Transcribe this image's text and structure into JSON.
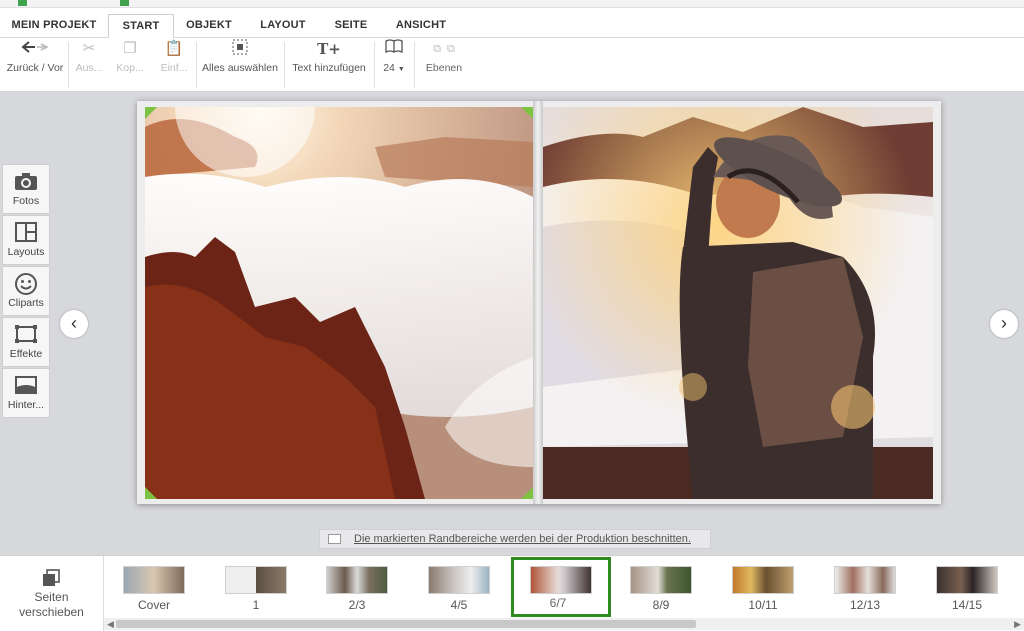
{
  "menu": {
    "tabs": [
      {
        "label": "MEIN PROJEKT"
      },
      {
        "label": "START"
      },
      {
        "label": "OBJEKT"
      },
      {
        "label": "LAYOUT"
      },
      {
        "label": "SEITE"
      },
      {
        "label": "ANSICHT"
      }
    ],
    "active_tab": "START"
  },
  "toolbar": {
    "undo_redo_label": "Zurück / Vor",
    "cut_label": "Aus...",
    "copy_label": "Kop...",
    "paste_label": "Einf...",
    "select_all_label": "Alles auswählen",
    "add_text_label": "Text hinzufügen",
    "font_size_value": "24",
    "layers_label": "Ebenen"
  },
  "sidepanel": {
    "items": [
      {
        "label": "Fotos",
        "icon": "camera-icon"
      },
      {
        "label": "Layouts",
        "icon": "layout-icon"
      },
      {
        "label": "Cliparts",
        "icon": "smiley-icon"
      },
      {
        "label": "Effekte",
        "icon": "frame-icon"
      },
      {
        "label": "Hinter...",
        "icon": "background-icon"
      }
    ]
  },
  "hint": {
    "text": "Die markierten Randbereiche werden bei der Produktion beschnitten."
  },
  "bottom": {
    "move_pages_label_1": "Seiten",
    "move_pages_label_2": "verschieben",
    "thumbnails": [
      {
        "label": "Cover"
      },
      {
        "label": "1"
      },
      {
        "label": "2/3"
      },
      {
        "label": "4/5"
      },
      {
        "label": "6/7"
      },
      {
        "label": "8/9"
      },
      {
        "label": "10/11"
      },
      {
        "label": "12/13"
      },
      {
        "label": "14/15"
      }
    ],
    "active_thumbnail": "6/7"
  },
  "colors": {
    "accent_green": "#2f8a1f",
    "crop_marker_green": "#7dc242"
  }
}
